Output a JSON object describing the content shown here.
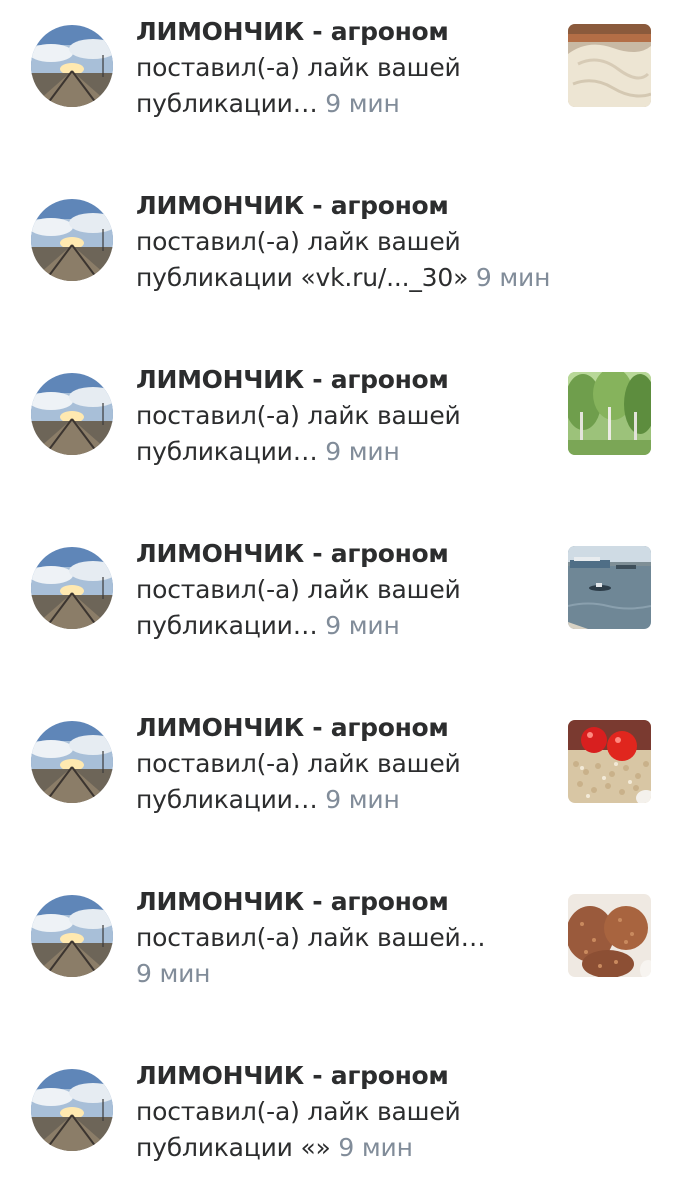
{
  "notifications": [
    {
      "author": "ЛИМОНЧИК - агроном",
      "line1": "поставил(-а) лайк вашей",
      "line2": "публикации…",
      "time": "9 мин",
      "thumbnail": "bread"
    },
    {
      "author": "ЛИМОНЧИК - агроном",
      "line1": "поставил(-а) лайк вашей",
      "line2": "публикации «vk.ru/..._30»",
      "time": "9 мин",
      "thumbnail": ""
    },
    {
      "author": "ЛИМОНЧИК - агроном",
      "line1": "поставил(-а) лайк вашей",
      "line2": "публикации…",
      "time": "9 мин",
      "thumbnail": "trees"
    },
    {
      "author": "ЛИМОНЧИК - агроном",
      "line1": "поставил(-а) лайк вашей",
      "line2": "публикации…",
      "time": "9 мин",
      "thumbnail": "river"
    },
    {
      "author": "ЛИМОНЧИК - агроном",
      "line1": "поставил(-а) лайк вашей",
      "line2": "публикации…",
      "time": "9 мин",
      "thumbnail": "tomatoes-porridge"
    },
    {
      "author": "ЛИМОНЧИК - агроном",
      "line1": "поставил(-а) лайк вашей…",
      "line2": "",
      "time": "9 мин",
      "thumbnail": "cutlets"
    },
    {
      "author": "ЛИМОНЧИК - агроном",
      "line1": "поставил(-а) лайк вашей",
      "line2": "публикации «»",
      "time": "9 мин",
      "thumbnail": ""
    }
  ],
  "colors": {
    "text": "#2c2d2e",
    "secondary": "#818c99",
    "background": "#ffffff"
  }
}
